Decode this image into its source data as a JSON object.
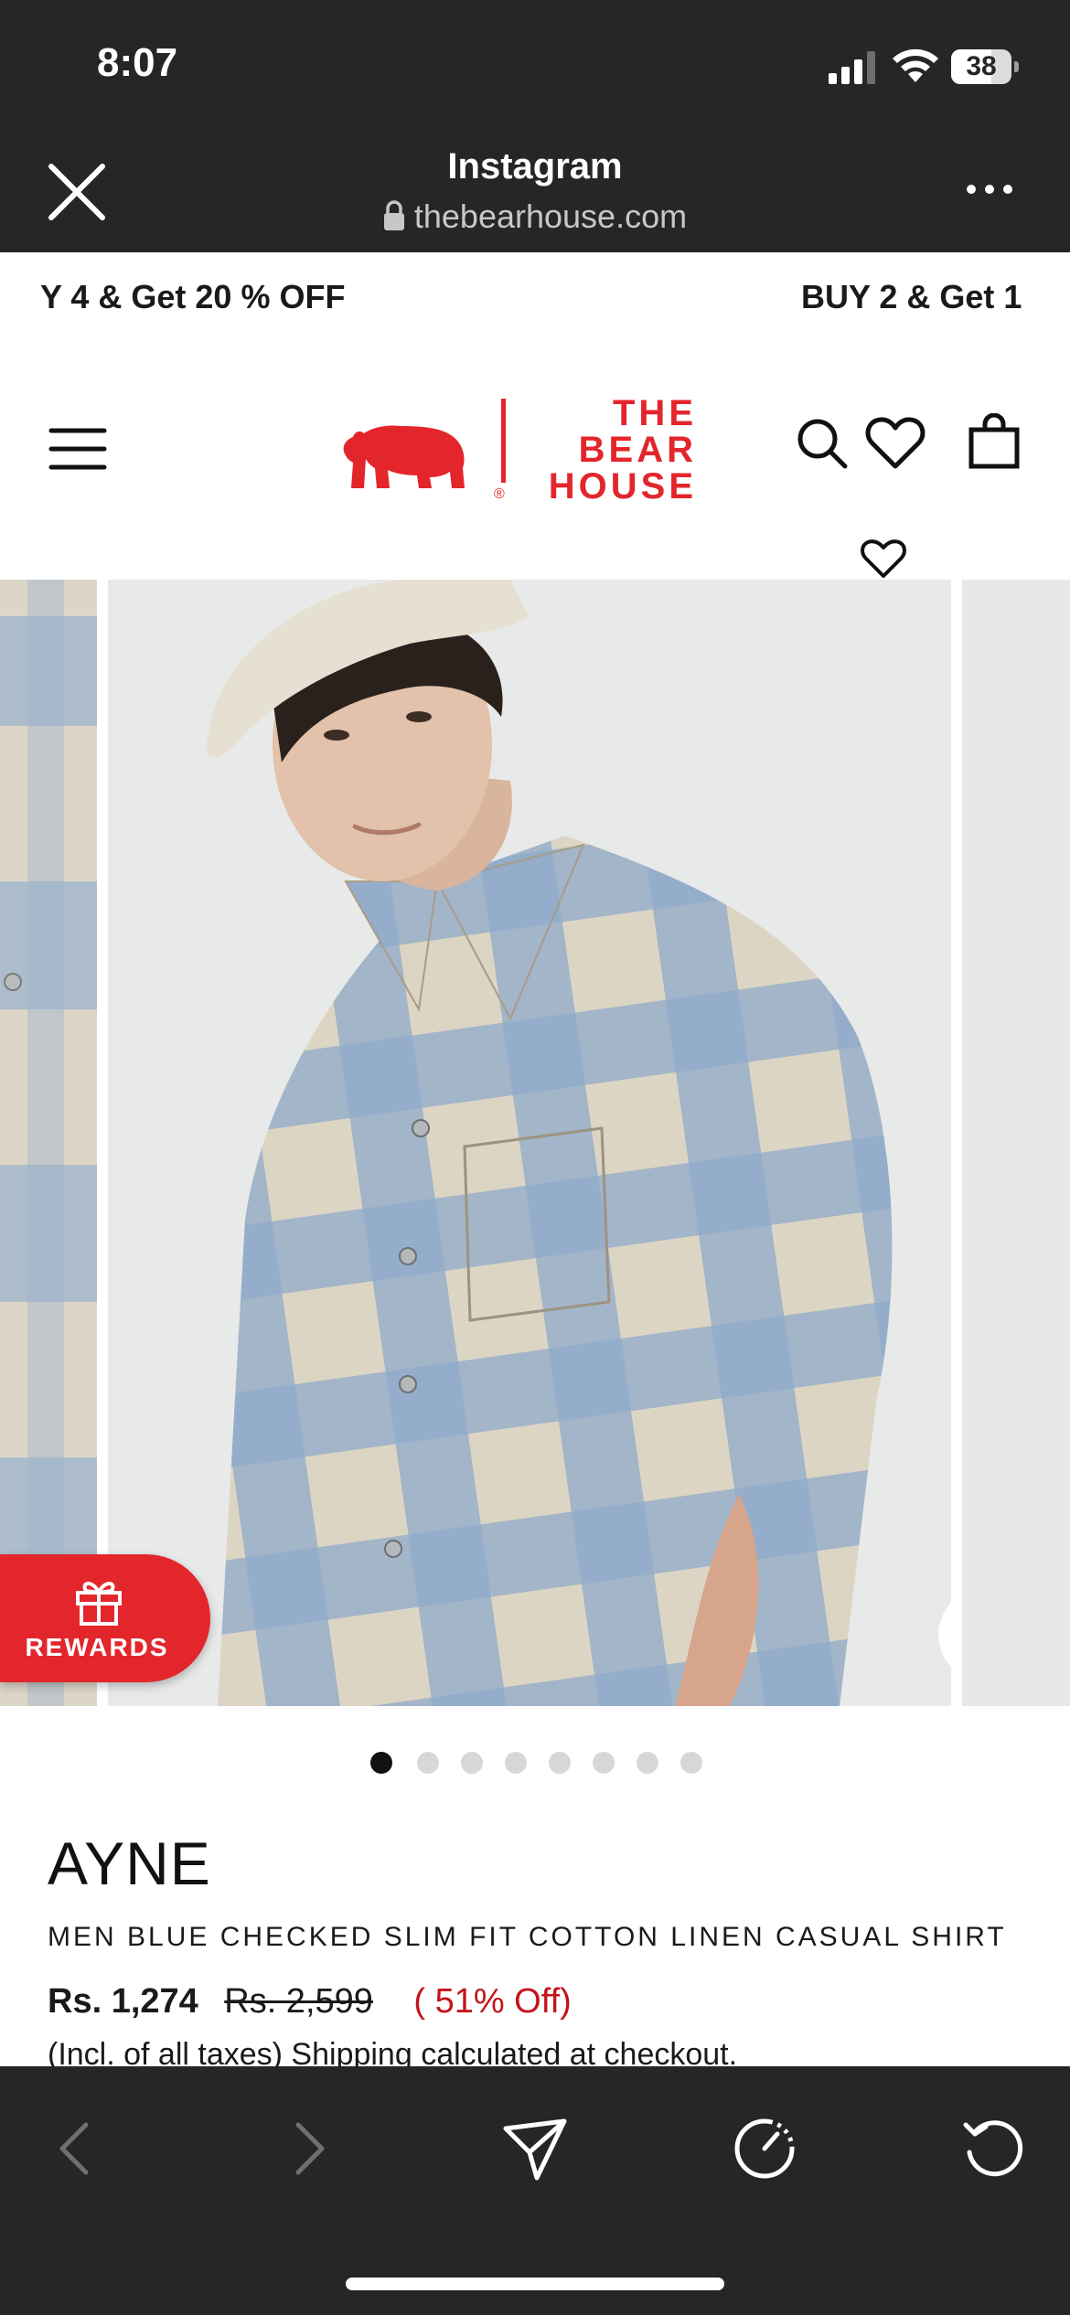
{
  "status_bar": {
    "time": "8:07",
    "battery": "38"
  },
  "browser": {
    "title": "Instagram",
    "url": "thebearhouse.com"
  },
  "promo": {
    "left_text": "Y 4 & Get 20 % OFF",
    "right_text": "BUY 2 & Get 1"
  },
  "site_header": {
    "logo_lines": [
      "THE",
      "BEAR",
      "HOUSE"
    ],
    "logo_reg": "®"
  },
  "gallery": {
    "slide_count": 8,
    "active_slide": 0
  },
  "rewards": {
    "label": "REWARDS"
  },
  "product": {
    "brand": "AYNE",
    "title": "MEN BLUE CHECKED SLIM FIT COTTON LINEN CASUAL SHIRT",
    "price": "Rs. 1,274",
    "original_price": "Rs. 2,599",
    "discount": "( 51% Off)",
    "tax_note": "(Incl. of all taxes) Shipping calculated at checkout."
  },
  "colors": {
    "brand_red": "#e3262c",
    "discount_red": "#c3151b",
    "chrome_dark": "#262626"
  },
  "icons": {
    "browser": [
      "close-icon",
      "lock-icon",
      "more-icon"
    ],
    "header": [
      "menu-icon",
      "search-icon",
      "heart-icon",
      "bag-icon"
    ],
    "toolbar": [
      "back-icon",
      "forward-icon",
      "share-icon",
      "compass-icon",
      "reload-icon"
    ]
  }
}
